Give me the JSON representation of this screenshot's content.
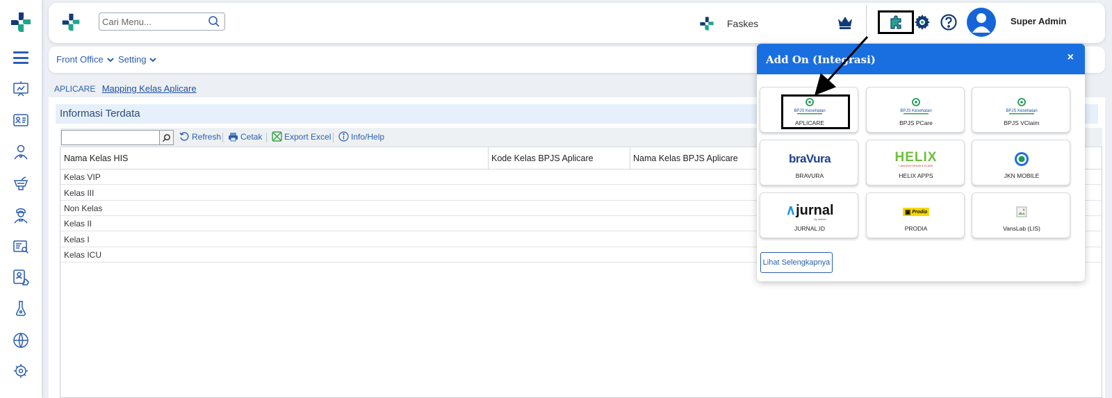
{
  "header": {
    "search_placeholder": "Cari Menu...",
    "facility_name": "Faskes",
    "user_name": "Super Admin"
  },
  "submenu": {
    "items": [
      {
        "label": "Front Office"
      },
      {
        "label": "Setting"
      }
    ]
  },
  "breadcrumb": {
    "module": "APLICARE",
    "page": "Mapping Kelas Aplicare"
  },
  "panel": {
    "title": "Informasi Terdata",
    "toolbar": {
      "refresh": "Refresh",
      "print": "Cetak",
      "export": "Export Excel",
      "info": "Info/Help"
    },
    "columns": [
      "Nama Kelas HIS",
      "Kode Kelas BPJS Aplicare",
      "Nama Kelas BPJS Aplicare"
    ],
    "rows": [
      {
        "nama_kelas_his": "Kelas VIP"
      },
      {
        "nama_kelas_his": "Kelas III"
      },
      {
        "nama_kelas_his": "Non Kelas"
      },
      {
        "nama_kelas_his": "Kelas II"
      },
      {
        "nama_kelas_his": "Kelas I"
      },
      {
        "nama_kelas_his": "Kelas ICU"
      }
    ]
  },
  "addon_popup": {
    "title": "Add On (Integrasi)",
    "close": "×",
    "cards": [
      {
        "label": "APLICARE",
        "logo_text": "BPJS Kesehatan"
      },
      {
        "label": "BPJS PCare",
        "logo_text": "BPJS Kesehatan"
      },
      {
        "label": "BPJS VClaim",
        "logo_text": "BPJS Kesehatan"
      },
      {
        "label": "BRAVURA",
        "logo_text": "braVura"
      },
      {
        "label": "HELIX APPS",
        "logo_text": "HELIX",
        "logo_sub": "LABORATORIUM & KLINIK"
      },
      {
        "label": "JKN MOBILE",
        "logo_text": ""
      },
      {
        "label": "JURNAL.ID",
        "logo_text": "jurnal",
        "logo_sub": "by mekari"
      },
      {
        "label": "PRODIA",
        "logo_text": "Prodia"
      },
      {
        "label": "VansLab (LIS)",
        "logo_text": ""
      }
    ],
    "more_button": "Lihat Selengkapnya"
  },
  "colors": {
    "brand_blue": "#1a6fe0",
    "nav_blue": "#2a5db0",
    "logo_teal": "#1fa58a",
    "logo_navy": "#123a78"
  }
}
